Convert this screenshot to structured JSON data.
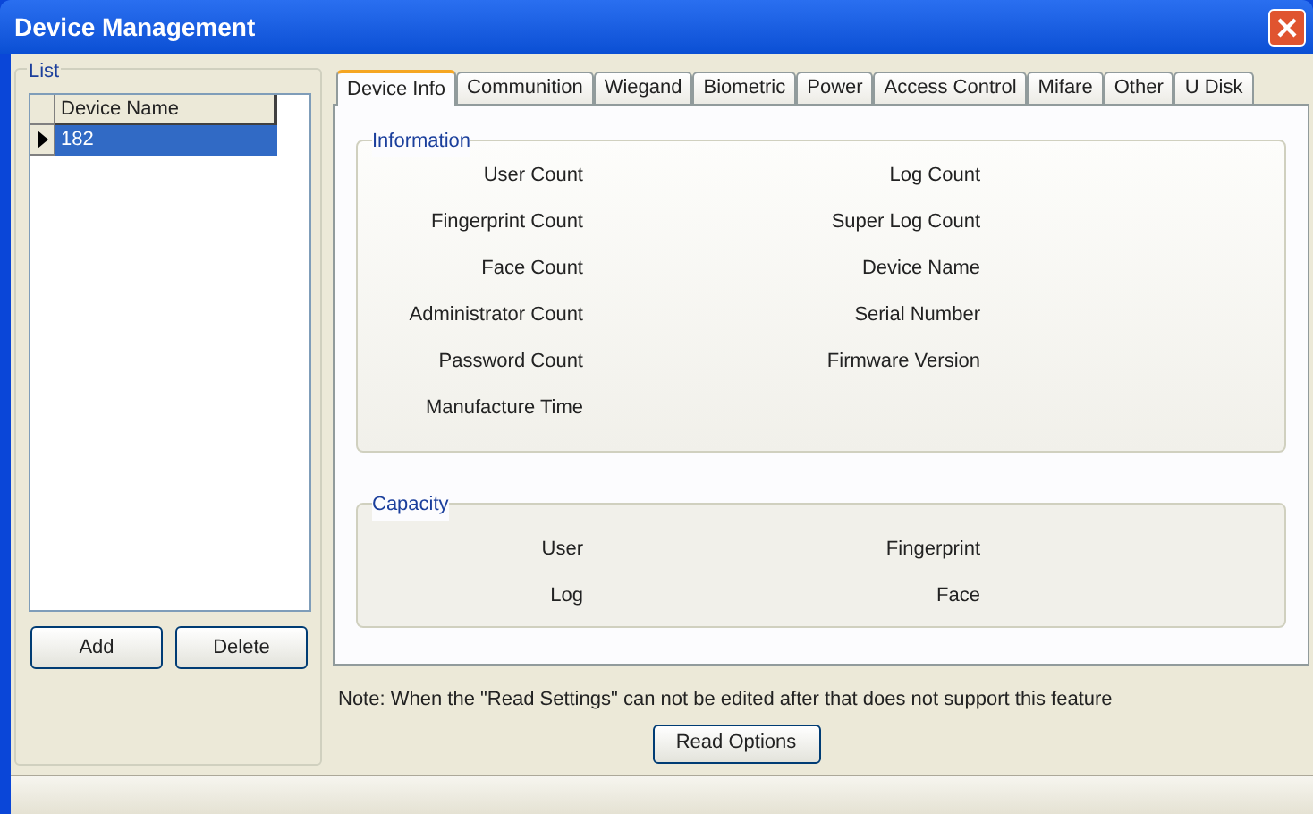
{
  "window": {
    "title": "Device Management"
  },
  "list": {
    "title": "List",
    "columns": [
      "Device Name"
    ],
    "rows": [
      {
        "name": "182",
        "selected": true
      }
    ]
  },
  "list_buttons": [
    "Add",
    "Delete"
  ],
  "tabs": [
    {
      "label": "Device Info",
      "selected": true
    },
    {
      "label": "Communition",
      "selected": false
    },
    {
      "label": "Wiegand",
      "selected": false
    },
    {
      "label": "Biometric",
      "selected": false
    },
    {
      "label": "Power",
      "selected": false
    },
    {
      "label": "Access Control",
      "selected": false
    },
    {
      "label": "Mifare",
      "selected": false
    },
    {
      "label": "Other",
      "selected": false
    },
    {
      "label": "U Disk",
      "selected": false
    }
  ],
  "information": {
    "title": "Information",
    "left": [
      "User Count",
      "Fingerprint Count",
      "Face Count",
      "Administrator Count",
      "Password Count",
      "Manufacture Time"
    ],
    "right": [
      "Log Count",
      "Super Log Count",
      "Device Name",
      "Serial Number",
      "Firmware Version"
    ]
  },
  "capacity": {
    "title": "Capacity",
    "left": [
      "User",
      "Log"
    ],
    "right": [
      "Fingerprint",
      "Face"
    ]
  },
  "note": "Note: When the \"Read Settings\" can not be edited after that does not support this feature",
  "read_button": "Read Options"
}
